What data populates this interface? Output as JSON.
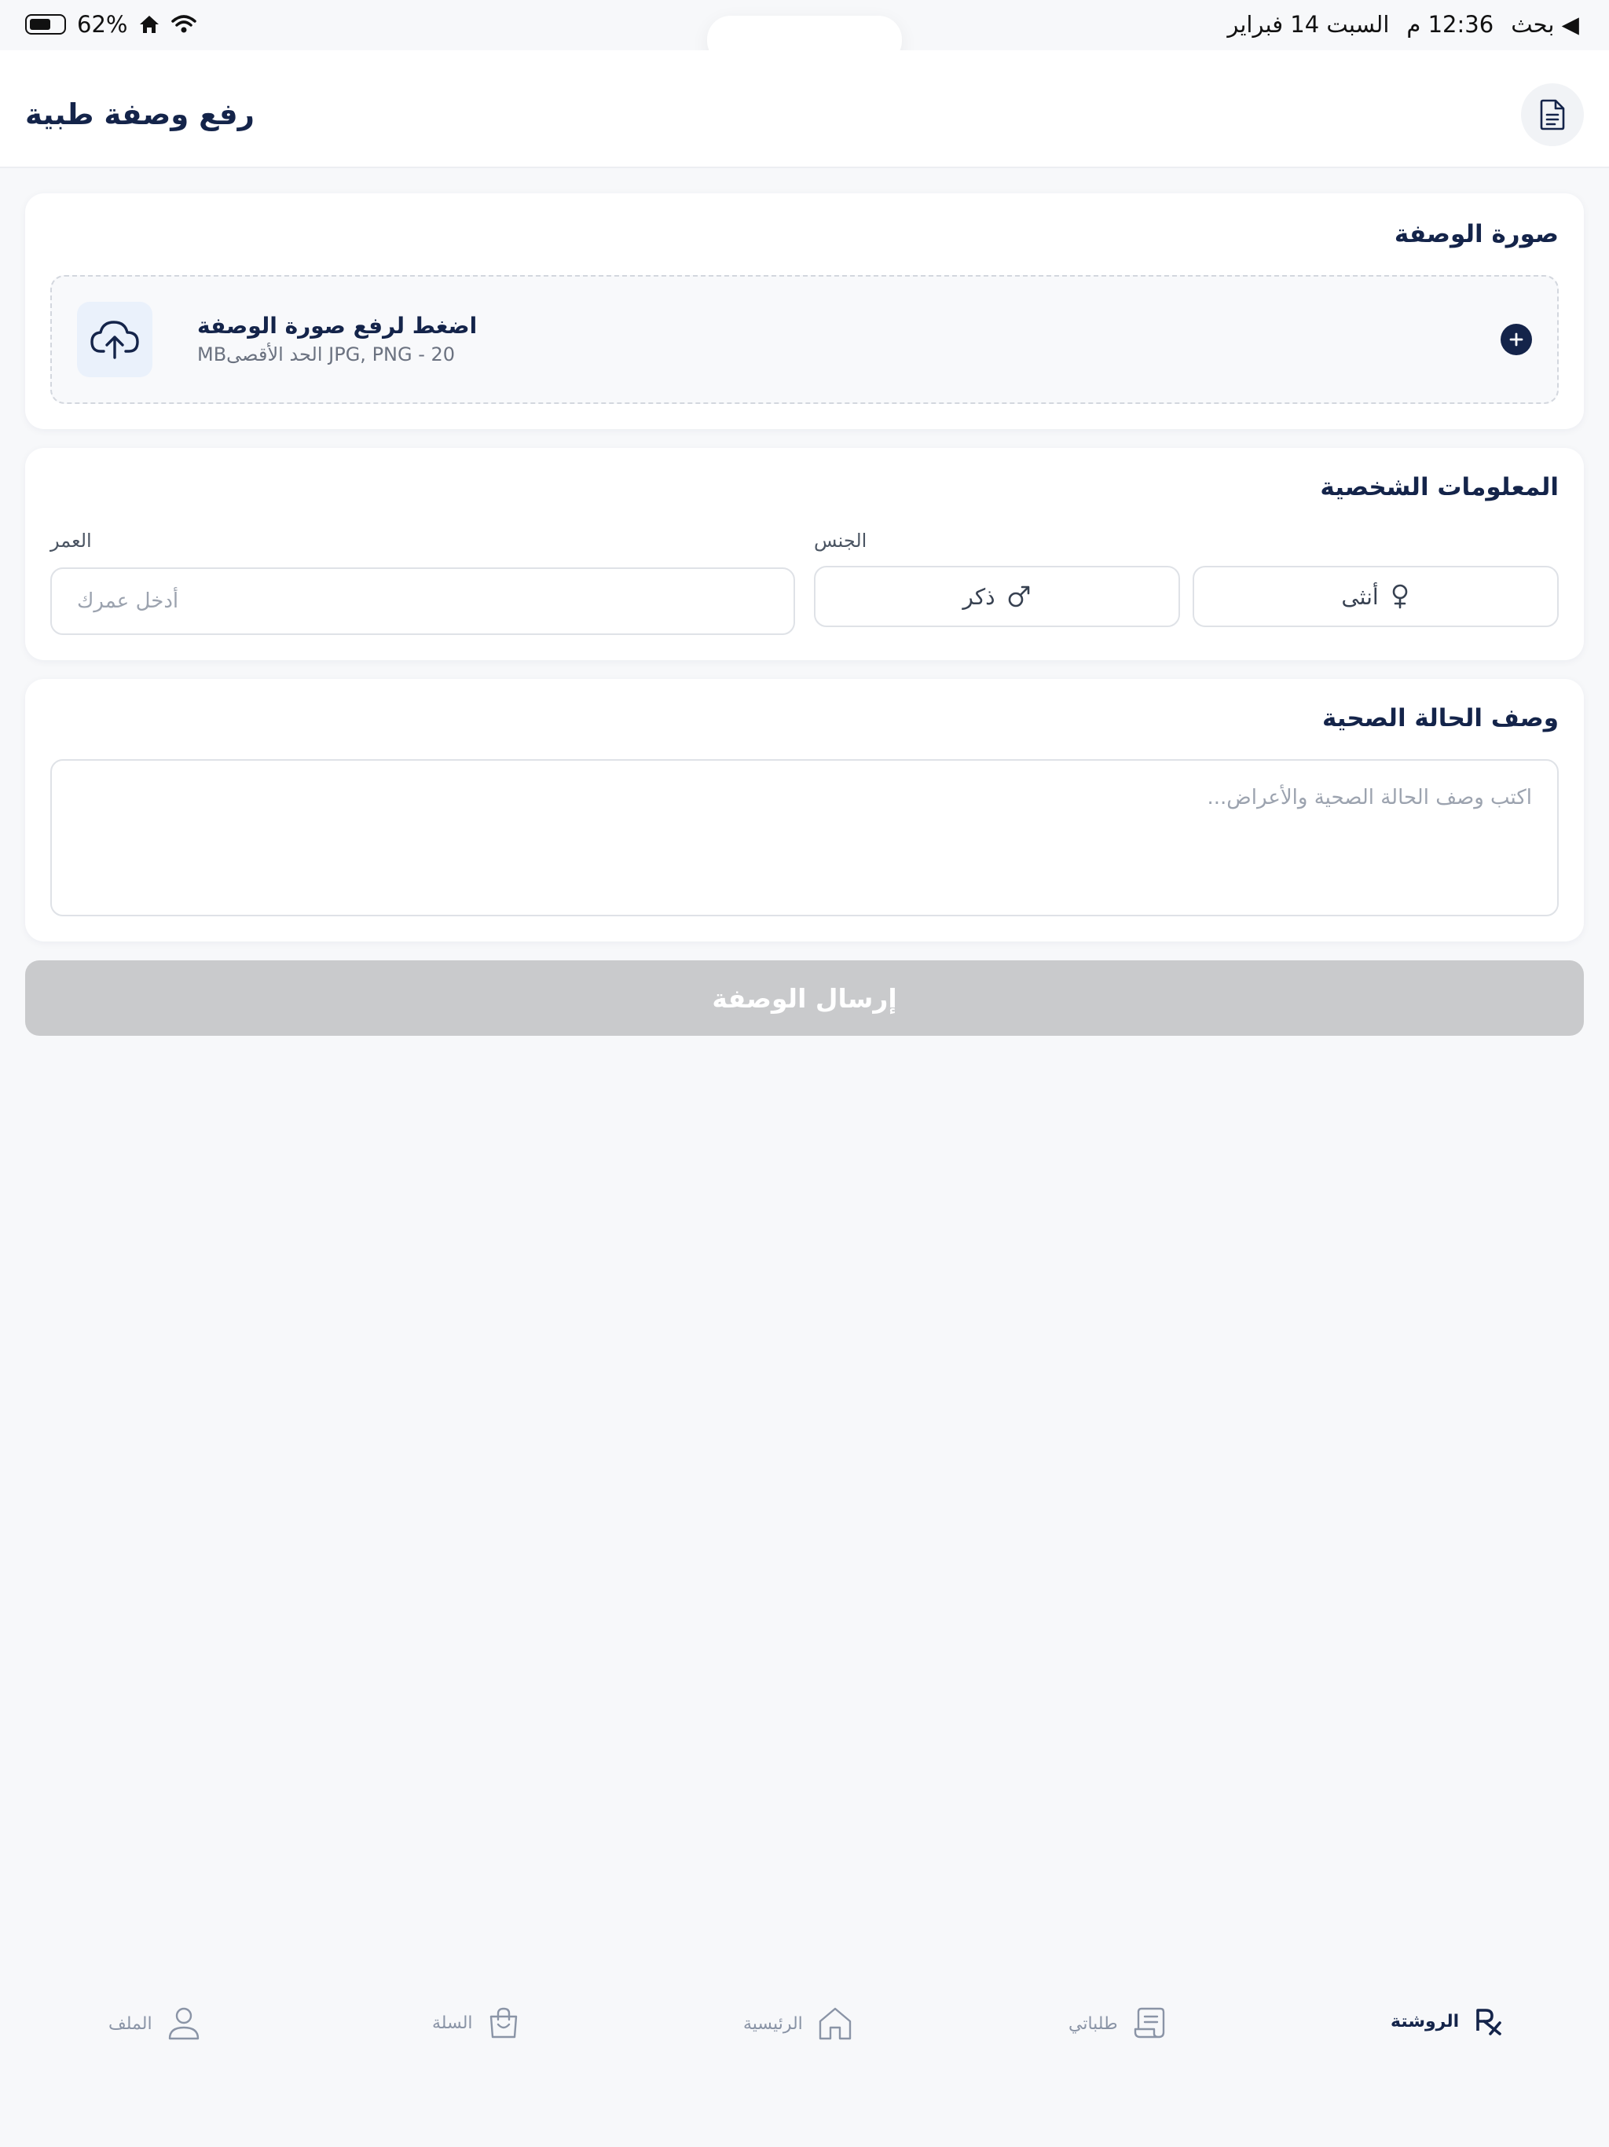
{
  "status_bar": {
    "back_label": "بحث",
    "time": "12:36 م",
    "date": "السبت 14 فبراير",
    "battery": "62%"
  },
  "header": {
    "title": "رفع وصفة طبية",
    "doc_icon": "document-icon"
  },
  "prescription_image": {
    "title": "صورة الوصفة",
    "upload_title": "اضغط لرفع صورة الوصفة",
    "upload_hint": "JPG, PNG - 20 الحد الأقصىMB",
    "upload_icon": "cloud-upload-icon",
    "add_icon": "plus-icon"
  },
  "personal_info": {
    "title": "المعلومات الشخصية",
    "gender_label": "الجنس",
    "age_label": "العمر",
    "age_placeholder": "أدخل عمرك",
    "female_label": "أنثى",
    "male_label": "ذكر"
  },
  "health": {
    "title": "وصف الحالة الصحية",
    "placeholder": "اكتب وصف الحالة الصحية والأعراض..."
  },
  "submit_label": "إرسال الوصفة",
  "nav": {
    "items": [
      {
        "label": "الروشتة",
        "icon": "rx-icon",
        "active": true
      },
      {
        "label": "طلباتي",
        "icon": "receipt-icon",
        "active": false
      },
      {
        "label": "الرئيسية",
        "icon": "home-icon",
        "active": false
      },
      {
        "label": "السلة",
        "icon": "bag-icon",
        "active": false
      },
      {
        "label": "الملف",
        "icon": "user-icon",
        "active": false
      }
    ]
  },
  "colors": {
    "primary": "#14244a",
    "background": "#f7f8fa",
    "submit_disabled": "#c9cacc"
  }
}
